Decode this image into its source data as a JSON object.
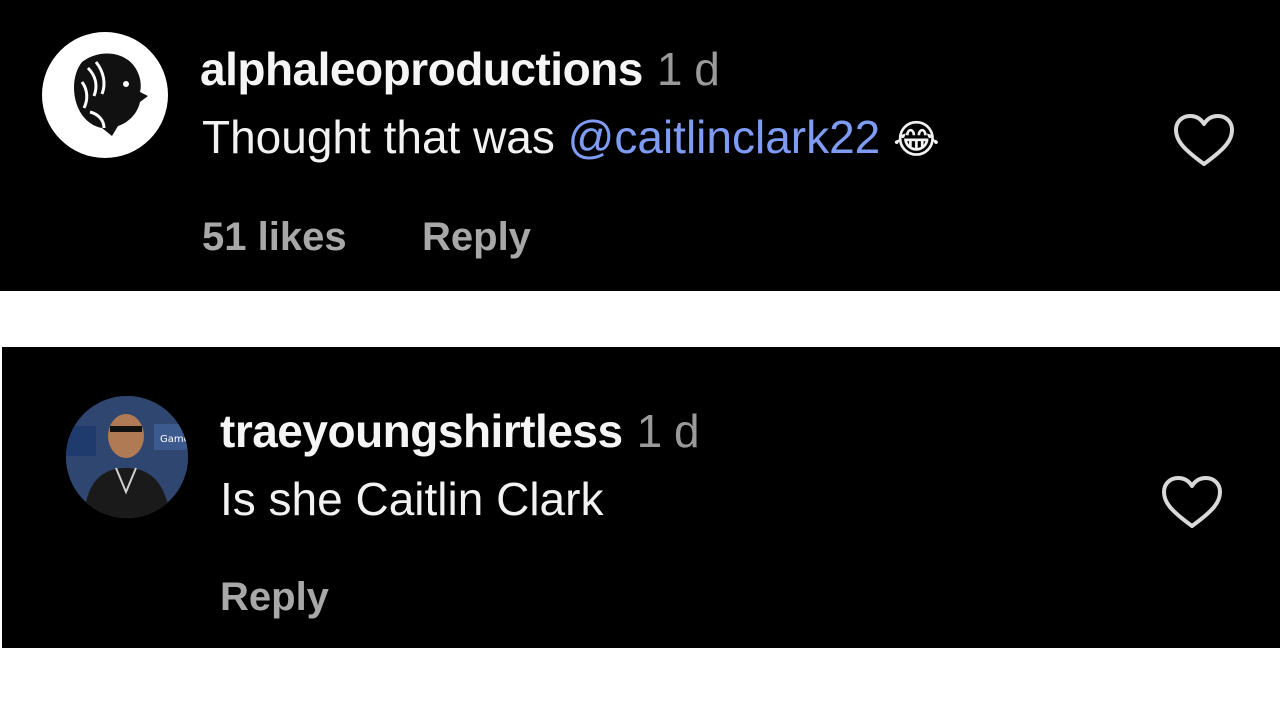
{
  "comments": [
    {
      "username": "alphaleoproductions",
      "time": "1 d",
      "text_prefix": "Thought that was ",
      "mention": "@caitlinclark22",
      "emoji": "😂",
      "likes": "51 likes",
      "reply_label": "Reply",
      "avatar_icon": "lion-logo-icon",
      "like_icon": "heart-outline-icon"
    },
    {
      "username": "traeyoungshirtless",
      "time": "1 d",
      "text": "Is she Caitlin Clark",
      "reply_label": "Reply",
      "avatar_icon": "profile-photo",
      "like_icon": "heart-outline-icon"
    }
  ],
  "colors": {
    "background": "#000000",
    "separator": "#ffffff",
    "mention": "#7f9cf5",
    "secondary_text": "#a8a8a8"
  }
}
